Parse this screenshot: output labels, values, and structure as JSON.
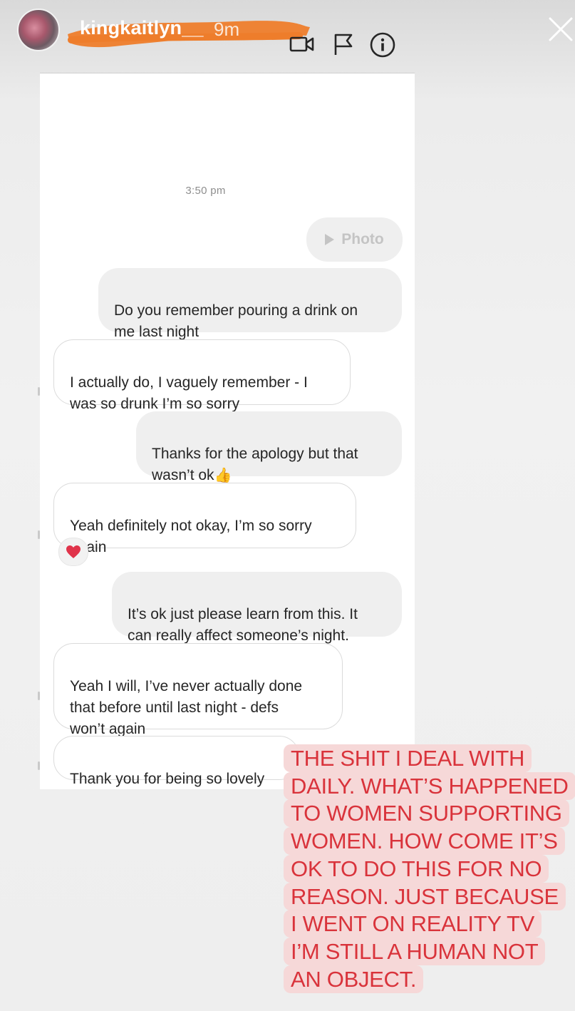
{
  "header": {
    "username": "kingkaitlyn__",
    "time_ago": "9m",
    "scribble_color": "#ee7d2b"
  },
  "chat": {
    "timestamp": "3:50 pm",
    "photo_label": "Photo",
    "messages": [
      {
        "side": "sent",
        "text": "Do you remember pouring a drink on\nme last night"
      },
      {
        "side": "received",
        "text": "I actually do, I vaguely remember - I\nwas so drunk I’m so sorry"
      },
      {
        "side": "sent",
        "text": "Thanks for the apology but that\nwasn’t ok",
        "emoji": "👍"
      },
      {
        "side": "received",
        "text": "Yeah definitely not okay, I’m so sorry\nagain",
        "reaction": "❤️"
      },
      {
        "side": "sent",
        "text": "It’s ok just please learn from this. It\ncan really affect someone’s night."
      },
      {
        "side": "received",
        "text": "Yeah I will, I’ve never actually done\nthat before until last night - defs\nwon’t again"
      },
      {
        "side": "received",
        "text": "Thank you for being so lovely"
      }
    ]
  },
  "caption": "THE SHIT I DEAL WITH DAILY. WHAT’S HAPPENED TO WOMEN SUPPORTING WOMEN. HOW  COME IT’S OK TO DO THIS FOR NO REASON. JUST BECAUSE I WENT ON REALITY TV I’M STILL A HUMAN NOT AN OBJECT.",
  "icons": [
    "video-call-icon",
    "flag-icon",
    "info-icon",
    "close-icon",
    "play-icon",
    "heart-icon"
  ],
  "colors": {
    "caption_text": "#d9333b",
    "caption_highlight": "#f6d6d6",
    "sent_bubble": "#efefef",
    "received_border": "#dbdbdb"
  }
}
